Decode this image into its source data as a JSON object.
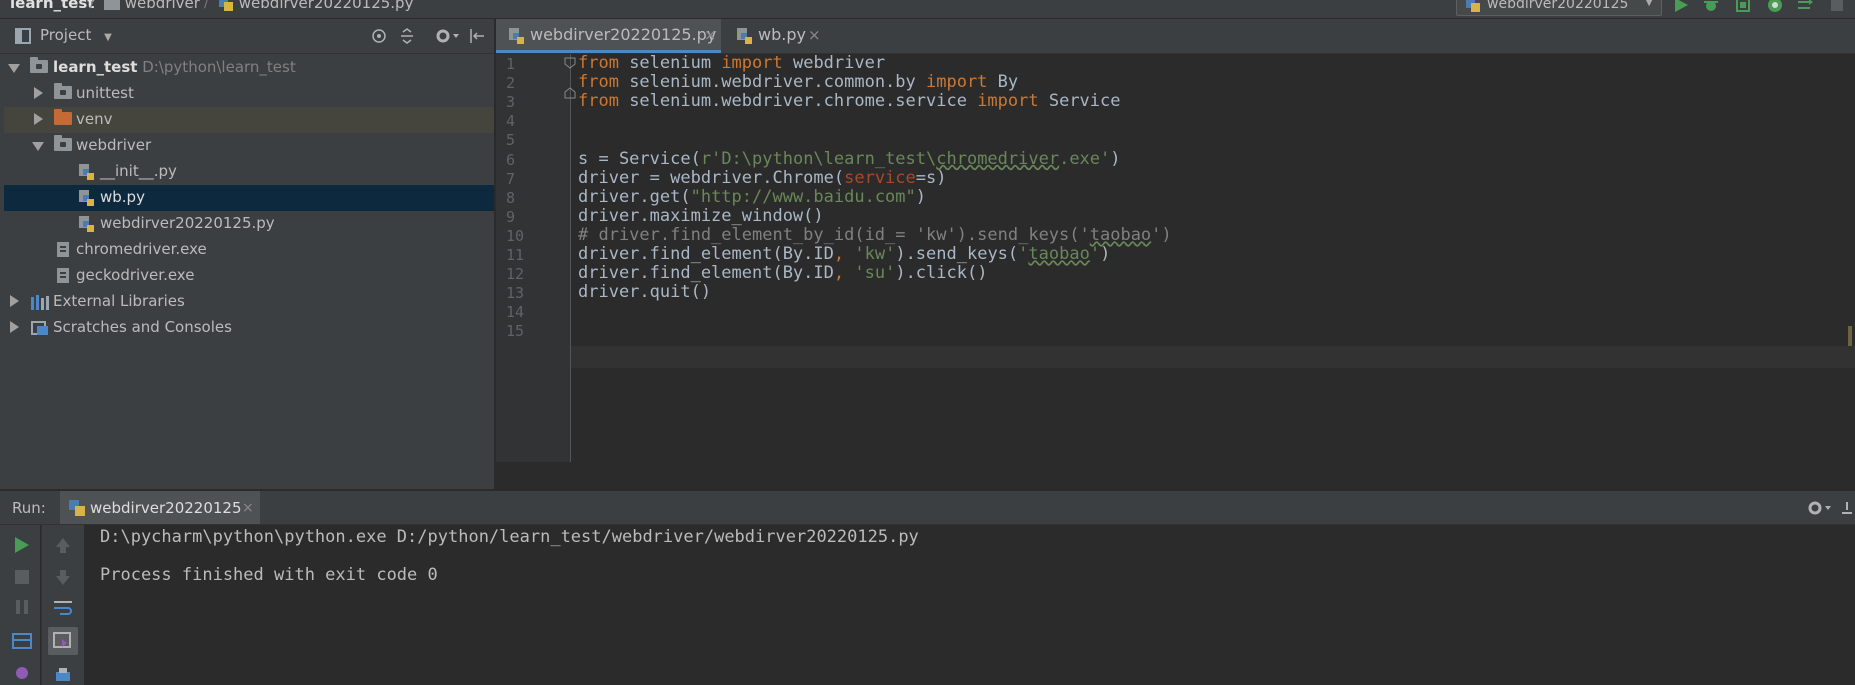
{
  "navbar": {
    "breadcrumbs": [
      "learn_test",
      "webdriver",
      "webdirver20220125.py"
    ],
    "run_config": "webdirver20220125"
  },
  "project_panel": {
    "title": "Project",
    "tree": [
      {
        "label": "learn_test",
        "path": "D:\\python\\learn_test"
      },
      {
        "label": "unittest"
      },
      {
        "label": "venv"
      },
      {
        "label": "webdriver"
      },
      {
        "label": "__init__.py"
      },
      {
        "label": "wb.py"
      },
      {
        "label": "webdirver20220125.py"
      },
      {
        "label": "chromedriver.exe"
      },
      {
        "label": "geckodriver.exe"
      },
      {
        "label": "External Libraries"
      },
      {
        "label": "Scratches and Consoles"
      }
    ]
  },
  "editor": {
    "tabs": [
      {
        "label": "webdirver20220125.py",
        "active": true
      },
      {
        "label": "wb.py",
        "active": false
      }
    ],
    "line_numbers": [
      "1",
      "2",
      "3",
      "4",
      "5",
      "6",
      "7",
      "8",
      "9",
      "10",
      "11",
      "12",
      "13",
      "14",
      "15"
    ],
    "code": [
      "from selenium import webdriver",
      "from selenium.webdriver.common.by import By",
      "from selenium.webdriver.chrome.service import Service",
      "",
      "",
      "s = Service(r'D:\\python\\learn_test\\chromedriver.exe')",
      "driver = webdriver.Chrome(service=s)",
      "driver.get(\"http://www.baidu.com\")",
      "driver.maximize_window()",
      "# driver.find_element_by_id(id_= 'kw').send_keys('taobao')",
      "driver.find_element(By.ID, 'kw').send_keys('taobao')",
      "driver.find_element(By.ID, 'su').click()",
      "driver.quit()",
      "",
      ""
    ]
  },
  "run_panel": {
    "label": "Run:",
    "tab_label": "webdirver20220125",
    "output": [
      "D:\\pycharm\\python\\python.exe D:/python/learn_test/webdriver/webdirver20220125.py",
      "",
      "Process finished with exit code 0"
    ]
  },
  "colors": {
    "keyword": "#cc7832",
    "string": "#6a8759",
    "comment": "#808080",
    "parameter": "#aa4926",
    "selection": "#0d293e",
    "run_green": "#499c54"
  }
}
